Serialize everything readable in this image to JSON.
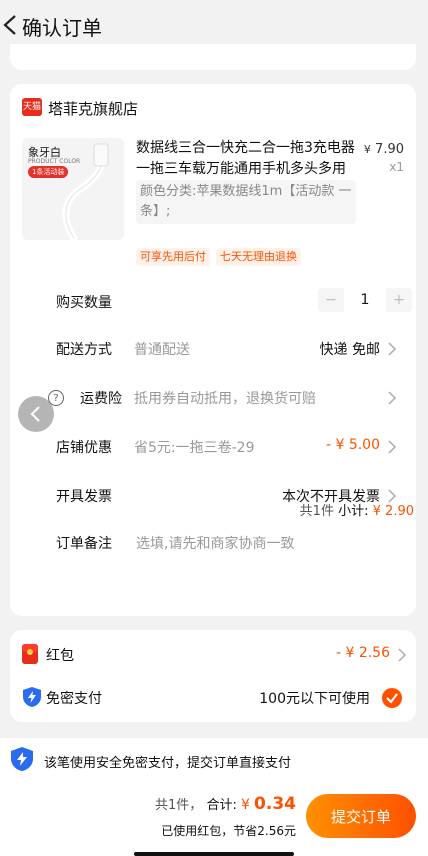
{
  "header": {
    "title": "确认订单"
  },
  "store": {
    "logo_text": "天猫",
    "name": "塔菲克旗舰店",
    "thumb": {
      "line1": "象牙白",
      "line2": "PRODUCT COLOR",
      "line3": "1条活动装"
    },
    "product_title": "数据线三合一快充二合一拖3充电器一拖三车载万能通用手机多头多用多...",
    "price_symbol": "¥",
    "price_value": "7.90",
    "quantity_label": "x1",
    "sku": "颜色分类:苹果数据线1m【活动款 一条】;",
    "tags": [
      "可享先用后付",
      "七天无理由退换"
    ]
  },
  "rows": {
    "quantity": {
      "label": "购买数量",
      "value": "1",
      "minus": "−",
      "plus": "+"
    },
    "shipping": {
      "label": "配送方式",
      "value": "普通配送",
      "right": "快递 免邮"
    },
    "insurance": {
      "label": "运费险",
      "value": "抵用券自动抵用，退换货可赔",
      "help": "?"
    },
    "discount": {
      "label": "店铺优惠",
      "value": "省5元:一拖三卷-29",
      "right": "- ¥ 5.00"
    },
    "invoice": {
      "label": "开具发票",
      "right": "本次不开具发票"
    },
    "note": {
      "label": "订单备注",
      "placeholder": "选填,请先和商家协商一致"
    }
  },
  "subtotal": {
    "count": "共1件",
    "label": "小计:",
    "symbol": "¥",
    "amount": "2.90"
  },
  "payment": {
    "redpacket": {
      "label": "红包",
      "right": "- ¥ 2.56"
    },
    "nopassword": {
      "label": "免密支付",
      "right": "100元以下可使用"
    }
  },
  "bottom": {
    "notice": "该笔使用安全免密支付，提交订单直接支付",
    "count": "共1件，",
    "total_label": "合计:",
    "symbol": "¥",
    "total_amount": "0.34",
    "discount_note": "已使用红包，节省2.56元",
    "submit": "提交订单"
  },
  "colors": {
    "accent": "#ff5000",
    "accent_gradient_start": "#ff9000",
    "security_blue": "#2a6cf0"
  }
}
